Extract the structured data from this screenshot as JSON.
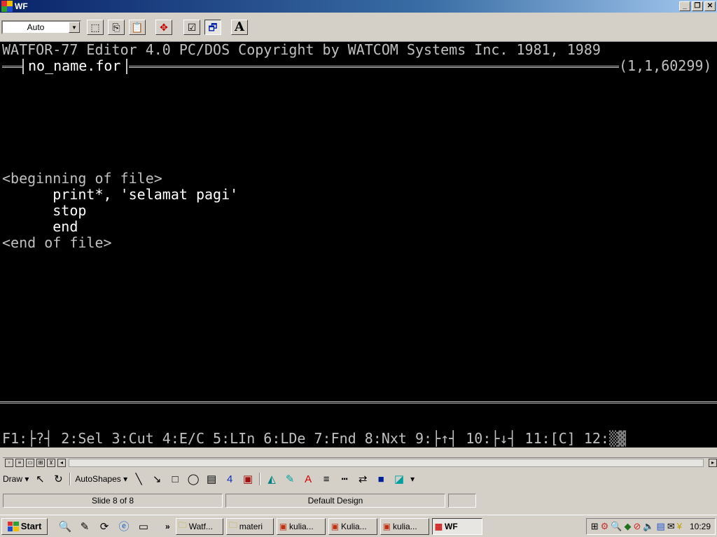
{
  "window": {
    "title": "WF"
  },
  "toolbar": {
    "font_size": "Auto"
  },
  "dos": {
    "banner": "WATFOR-77 Editor 4.0 PC/DOS Copyright by WATCOM Systems Inc. 1981, 1989",
    "filename": "no_name.for",
    "cursor_pos": "(1,1,60299)",
    "lines": [
      "<beginning of file>",
      "      print*, 'selamat pagi'",
      "      stop",
      "      end",
      "<end of file>"
    ],
    "fkeys": "F1:├?┤ 2:Sel 3:Cut 4:E/C 5:LIn 6:LDe 7:Fnd 8:Nxt 9:├↑┤ 10:├↓┤ 11:[C] 12:"
  },
  "ppt": {
    "draw_label": "Draw",
    "autoshapes_label": "AutoShapes",
    "slide_status": "Slide 8 of 8",
    "design_status": "Default Design"
  },
  "taskbar": {
    "start": "Start",
    "tasks": [
      "Watf...",
      "materi",
      "kulia...",
      "Kulia...",
      "kulia...",
      "WF"
    ],
    "clock": "10:29"
  }
}
